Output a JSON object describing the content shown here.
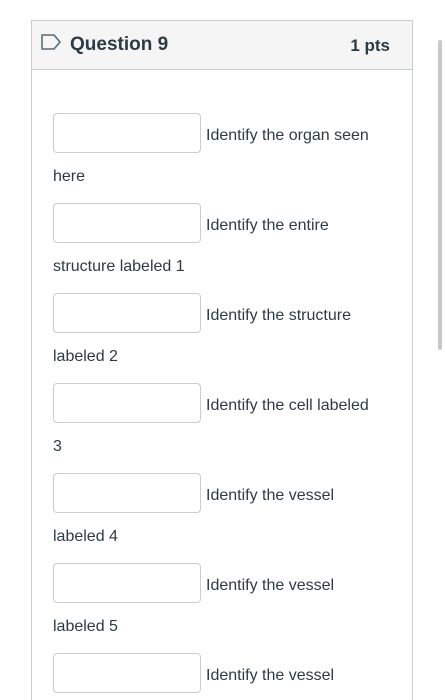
{
  "question": {
    "title": "Question 9",
    "points": "1 pts"
  },
  "items": [
    {
      "prompt_start": "Identify the organ seen",
      "prompt_end": "here"
    },
    {
      "prompt_start": "Identify the entire",
      "prompt_end": "structure labeled 1"
    },
    {
      "prompt_start": "Identify the structure",
      "prompt_end": "labeled 2"
    },
    {
      "prompt_start": "Identify the cell labeled",
      "prompt_end": "3"
    },
    {
      "prompt_start": "Identify the vessel",
      "prompt_end": "labeled 4"
    },
    {
      "prompt_start": "Identify the vessel",
      "prompt_end": "labeled 5"
    },
    {
      "prompt_start": "Identify the vessel",
      "prompt_end": ""
    }
  ],
  "icons": {
    "flag": "flag-outline-icon"
  },
  "colors": {
    "header_bg": "#f5f5f5",
    "border": "#c7cdd1",
    "text": "#2d3b45"
  }
}
